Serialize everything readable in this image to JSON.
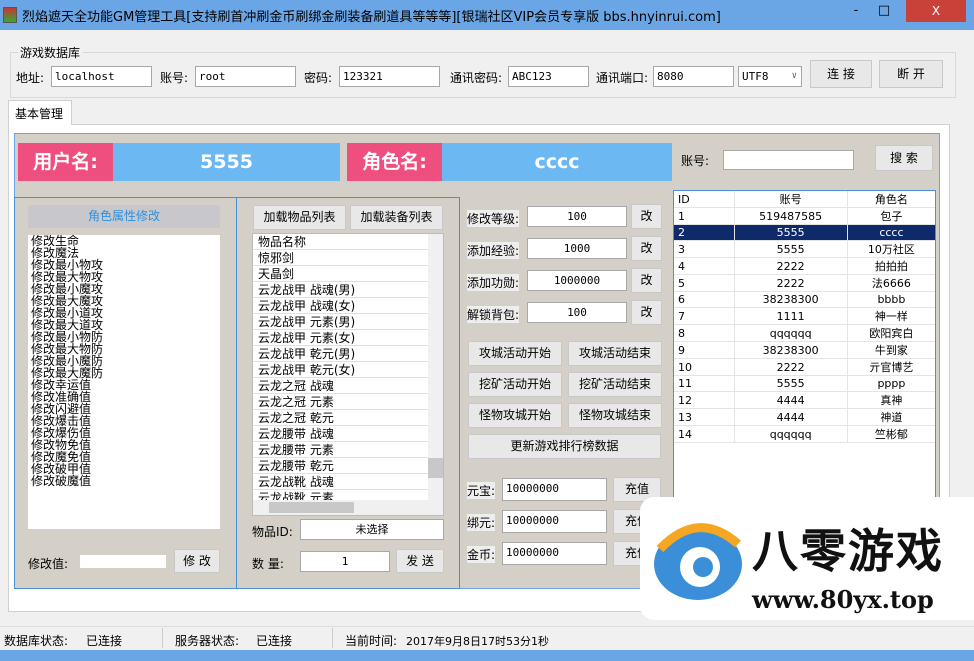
{
  "window": {
    "title": "烈焰遮天全功能GM管理工具[支持刷首冲刷金币刷绑金刷装备刷道具等等等][银瑞社区VIP会员专享版 bbs.hnyinrui.com]",
    "minimize": "-",
    "maximize": "□",
    "close": "X"
  },
  "db": {
    "group_label": "游戏数据库",
    "address_label": "地址:",
    "address": "localhost",
    "account_label": "账号:",
    "account": "root",
    "password_label": "密码:",
    "password": "123321",
    "comm_password_label": "通讯密码:",
    "comm_password": "ABC123",
    "comm_port_label": "通讯端口:",
    "comm_port": "8080",
    "encoding": "UTF8",
    "connect": "连 接",
    "disconnect": "断 开"
  },
  "tabs": [
    {
      "label": "基本管理",
      "active": true
    }
  ],
  "header": {
    "username_label": "用户名:",
    "username": "5555",
    "rolename_label": "角色名:",
    "rolename": "cccc",
    "search_account_label": "账号:",
    "search_account": "",
    "search_button": "搜 索"
  },
  "attr": {
    "title": "角色属性修改",
    "items": [
      "修改生命",
      "修改魔法",
      "修改最小物攻",
      "修改最大物攻",
      "修改最小魔攻",
      "修改最大魔攻",
      "修改最小道攻",
      "修改最大道攻",
      "修改最小物防",
      "修改最大物防",
      "修改最小魔防",
      "修改最大魔防",
      "修改幸运值",
      "修改准确值",
      "修改闪避值",
      "修改爆击值",
      "修改爆伤值",
      "修改物免值",
      "修改魔免值",
      "修改破甲值",
      "修改破魔值"
    ],
    "value_label": "修改值:",
    "value": "",
    "modify_button": "修 改"
  },
  "items": {
    "load_items": "加载物品列表",
    "load_equip": "加载装备列表",
    "list": [
      "物品名称",
      "惊邪剑",
      "天晶剑",
      "云龙战甲 战魂(男)",
      "云龙战甲 战魂(女)",
      "云龙战甲 元素(男)",
      "云龙战甲 元素(女)",
      "云龙战甲 乾元(男)",
      "云龙战甲 乾元(女)",
      "云龙之冠 战魂",
      "云龙之冠 元素",
      "云龙之冠 乾元",
      "云龙腰带 战魂",
      "云龙腰带 元素",
      "云龙腰带 乾元",
      "云龙战靴 战魂",
      "云龙战靴 元素"
    ],
    "item_id_label": "物品ID:",
    "item_id": "未选择",
    "qty_label": "数 量:",
    "qty": "1",
    "send": "发 送"
  },
  "ops": {
    "rows": [
      {
        "label": "修改等级:",
        "value": "100",
        "button": "改"
      },
      {
        "label": "添加经验:",
        "value": "1000",
        "button": "改"
      },
      {
        "label": "添加功勋:",
        "value": "1000000",
        "button": "改"
      },
      {
        "label": "解锁背包:",
        "value": "100",
        "button": "改"
      }
    ],
    "events": [
      "攻城活动开始",
      "攻城活动结束",
      "挖矿活动开始",
      "挖矿活动结束",
      "怪物攻城开始",
      "怪物攻城结束"
    ],
    "update_rank": "更新游戏排行榜数据",
    "recharge": [
      {
        "label": "元宝:",
        "value": "10000000",
        "button": "充值"
      },
      {
        "label": "绑元:",
        "value": "10000000",
        "button": "充值"
      },
      {
        "label": "金币:",
        "value": "10000000",
        "button": "充值"
      }
    ]
  },
  "table": {
    "columns": [
      "ID",
      "账号",
      "角色名"
    ],
    "rows": [
      [
        "1",
        "519487585",
        "包子"
      ],
      [
        "2",
        "5555",
        "cccc"
      ],
      [
        "3",
        "5555",
        "10万社区"
      ],
      [
        "4",
        "2222",
        "拍拍拍"
      ],
      [
        "5",
        "2222",
        "法6666"
      ],
      [
        "6",
        "38238300",
        "bbbb"
      ],
      [
        "7",
        "1111",
        "神一样"
      ],
      [
        "8",
        "qqqqqq",
        "欧阳宾白"
      ],
      [
        "9",
        "38238300",
        "牛到家"
      ],
      [
        "10",
        "2222",
        "亓官博艺"
      ],
      [
        "11",
        "5555",
        "pppp"
      ],
      [
        "12",
        "4444",
        "真神"
      ],
      [
        "13",
        "4444",
        "神道"
      ],
      [
        "14",
        "qqqqqq",
        "竺彬郁"
      ]
    ],
    "selected_index": 1
  },
  "status": {
    "db_label": "数据库状态:",
    "db": "已连接",
    "server_label": "服务器状态:",
    "server": "已连接",
    "time_label": "当前时间:",
    "time": "2017年9月8日17时53分1秒"
  },
  "watermark": {
    "name": "八零游戏",
    "url": "www.80yx.top"
  },
  "colors": {
    "pink": "#ee4f7e",
    "blue": "#6cb8f2",
    "titlebar": "#6aa6e6",
    "selection": "#0f2a6a"
  }
}
